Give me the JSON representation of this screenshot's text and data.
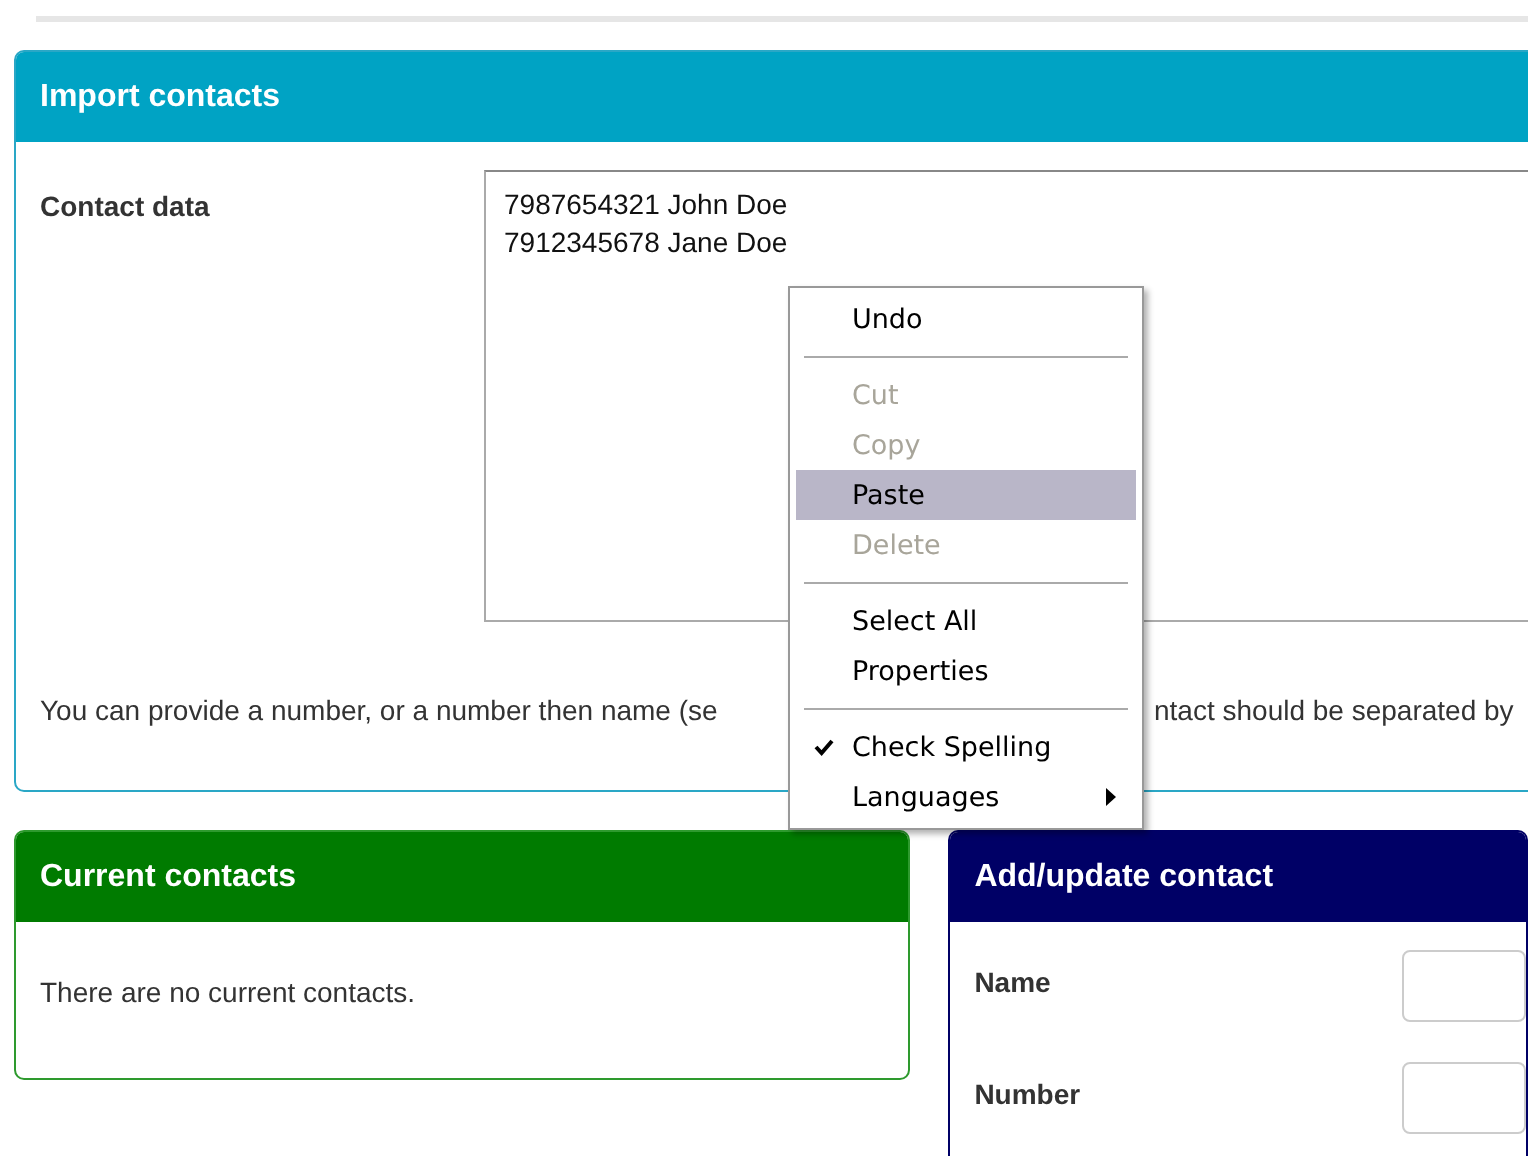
{
  "import_panel": {
    "title": "Import contacts",
    "field_label": "Contact data",
    "value": "7987654321 John Doe\n7912345678 Jane Doe",
    "help_text_visible": [
      "You can provide a number, or a number then name (se",
      "ntact should be separated by"
    ]
  },
  "context_menu": {
    "items": [
      {
        "kind": "item",
        "label": "Undo",
        "disabled": false,
        "selected": false
      },
      {
        "kind": "separator"
      },
      {
        "kind": "item",
        "label": "Cut",
        "disabled": true,
        "selected": false
      },
      {
        "kind": "item",
        "label": "Copy",
        "disabled": true,
        "selected": false
      },
      {
        "kind": "item",
        "label": "Paste",
        "disabled": false,
        "selected": true
      },
      {
        "kind": "item",
        "label": "Delete",
        "disabled": true,
        "selected": false
      },
      {
        "kind": "separator"
      },
      {
        "kind": "item",
        "label": "Select All",
        "disabled": false,
        "selected": false
      },
      {
        "kind": "item",
        "label": "Properties",
        "disabled": false,
        "selected": false
      },
      {
        "kind": "separator"
      },
      {
        "kind": "check",
        "label": "Check Spelling",
        "disabled": false,
        "selected": false,
        "checked": true
      },
      {
        "kind": "submenu",
        "label": "Languages",
        "disabled": false,
        "selected": false
      }
    ]
  },
  "current_contacts": {
    "title": "Current contacts",
    "empty_text": "There are no current contacts."
  },
  "add_update": {
    "title": "Add/update contact",
    "fields": [
      {
        "label": "Name"
      },
      {
        "label": "Number"
      }
    ]
  }
}
